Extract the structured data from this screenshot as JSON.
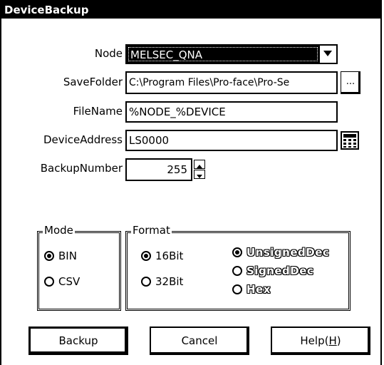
{
  "window": {
    "title": "DeviceBackup"
  },
  "fields": {
    "node": {
      "label": "Node",
      "value": "MELSEC_QNA"
    },
    "save_folder": {
      "label": "SaveFolder",
      "value": "C:\\Program Files\\Pro-face\\Pro-Se",
      "browse_label": "..."
    },
    "file_name": {
      "label": "FileName",
      "value": "%NODE_%DEVICE"
    },
    "device_address": {
      "label": "DeviceAddress",
      "value": "LS0000"
    },
    "backup_number": {
      "label": "BackupNumber",
      "value": "255"
    }
  },
  "mode_group": {
    "title": "Mode",
    "options": [
      {
        "label": "BIN",
        "checked": true
      },
      {
        "label": "CSV",
        "checked": false
      }
    ]
  },
  "format_group": {
    "title": "Format",
    "bit_options": [
      {
        "label": "16Bit",
        "checked": true
      },
      {
        "label": "32Bit",
        "checked": false
      }
    ],
    "type_options": [
      {
        "label": "UnsignedDec",
        "checked": true,
        "enabled": false
      },
      {
        "label": "SignedDec",
        "checked": false,
        "enabled": false
      },
      {
        "label": "Hex",
        "checked": false,
        "enabled": false
      }
    ]
  },
  "buttons": {
    "backup": "Backup",
    "cancel": "Cancel",
    "help_prefix": "Help(",
    "help_mnemonic": "H",
    "help_suffix": ")"
  },
  "icons": {
    "dropdown": "chevron-down-icon",
    "calculator": "calculator-icon",
    "spin": "spin-updown-icon"
  }
}
